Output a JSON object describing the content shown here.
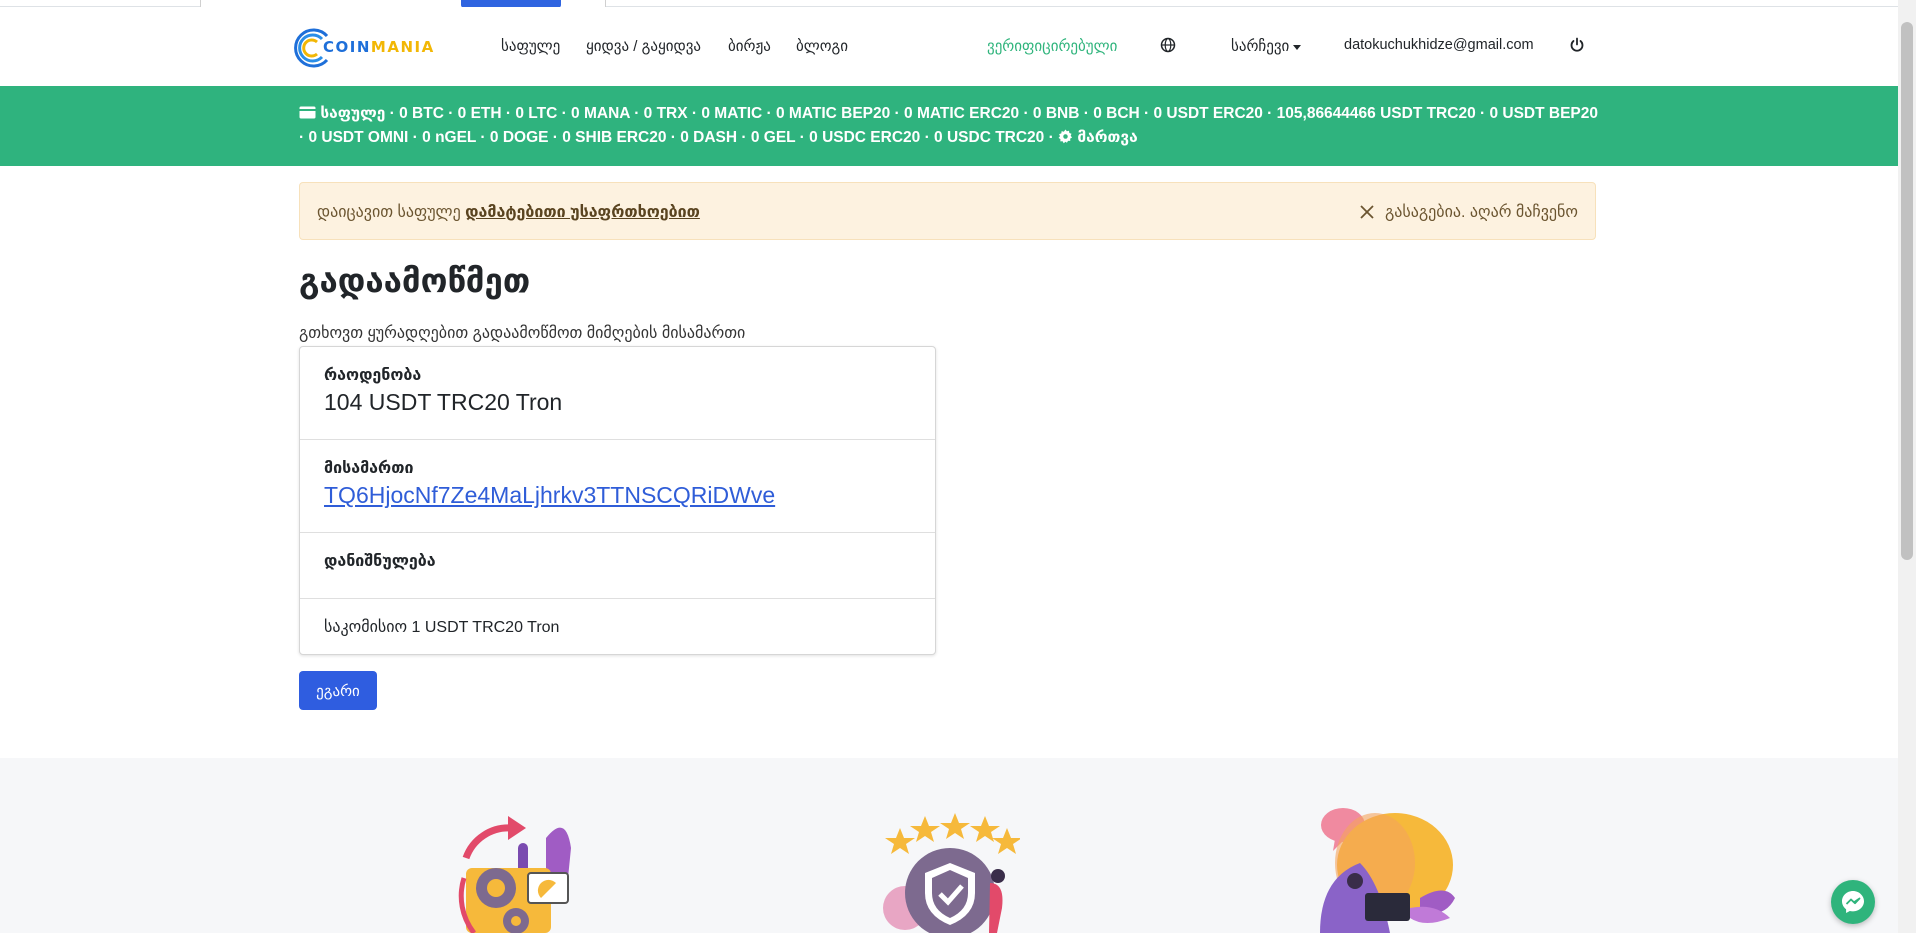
{
  "navbar": {
    "logo_text_a": "COIN",
    "logo_text_b": "MANIA",
    "links": [
      "საფულე",
      "ყიდვა / გაყიდვა",
      "ბირჟა",
      "ბლოგი"
    ],
    "verified": "ვერიფიცირებული",
    "language_icon": "globe-icon",
    "settings_label": "სარჩევი",
    "email": "datokuchukhidze@gmail.com",
    "logout_icon": "power-icon"
  },
  "wallet_bar": {
    "icon": "wallet-icon",
    "label": "საფულე",
    "balances_text": " · 0 BTC · 0 ETH · 0 LTC · 0 MANA · 0 TRX · 0 MATIC · 0 MATIC BEP20 · 0 MATIC ERC20 · 0 BNB · 0 BCH · 0 USDT ERC20 · 105,86644466 USDT TRC20 · 0 USDT BEP20 · 0 USDT OMNI · 0 nGEL · 0 DOGE · 0 SHIB ERC20 · 0 DASH · 0 GEL · 0 USDC ERC20 · 0 USDC TRC20 · ",
    "manage_icon": "gear-icon",
    "manage_label": "მართვა"
  },
  "alert": {
    "prefix": "დაიცავით საფულე ",
    "link": "დამატებითი უსაფრთხოებით",
    "dismiss": "გასაგებია. აღარ მაჩვენო"
  },
  "page": {
    "title": "გადაამოწმეთ",
    "subtitle": "გთხოვთ ყურადღებით გადაამოწმოთ მიმღების მისამართი"
  },
  "confirm": {
    "amount_label": "რაოდენობა",
    "amount_value": "104 USDT TRC20 Tron",
    "address_label": "მისამართი",
    "address_value": "TQ6HjocNf7Ze4MaLjhrkv3TTNSCQRiDWve",
    "purpose_label": "დანიშნულება",
    "fee": "საკომისიო 1 USDT TRC20 Tron"
  },
  "agree_button": "ეგარი",
  "colors": {
    "green": "#2fb37e",
    "primary": "#2f5de0",
    "alert_bg": "#fdf2e0"
  }
}
